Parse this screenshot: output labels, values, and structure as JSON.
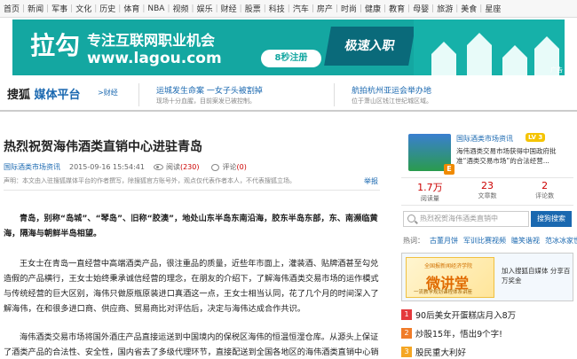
{
  "topnav": [
    "首页",
    "新闻",
    "军事",
    "文化",
    "历史",
    "体育",
    "NBA",
    "视频",
    "娱乐",
    "财经",
    "股票",
    "科技",
    "汽车",
    "房产",
    "时尚",
    "健康",
    "教育",
    "母婴",
    "旅游",
    "美食",
    "星座"
  ],
  "banner": {
    "logo": "拉勾",
    "slogan": "专注互联网职业机会",
    "url": "www.lagou.com",
    "register": "8秒注册",
    "fast": "极速入职",
    "ad_label": "广告"
  },
  "media": {
    "brand": "搜狐",
    "brand_sub": "媒体平台",
    "brand_tag": ">财经",
    "h1": "运城发生命案 一女子头被割掉",
    "h1_sub": "现场十分血腥，目前案发已被控制。",
    "h2": "航拍杭州亚运会举办地",
    "h2_sub": "位于萧山区钱江世纪城区域。"
  },
  "article": {
    "title": "热烈祝贺海伟酒类直销中心进驻青岛",
    "source": "国际酒类市场资讯",
    "time": "2015-09-16 15:54:41",
    "views_label": "阅读",
    "views": "(230)",
    "comments_label": "评论",
    "comments": "(0)",
    "notice": "声明：本文由入驻搜狐媒体平台的作者撰写，除搜狐官方账号外，观点仅代表作者本人，不代表搜狐立场。",
    "report": "举报",
    "paragraphs": [
      "青岛，别称“岛城”、“琴岛”、旧称“胶澳”，地处山东半岛东南沿海，胶东半岛东部，东、南濒临黄海，隔海与朝鲜半岛相望。",
      "王女士在青岛一直经营中高端酒类产品，很注重品的质量，近些年市面上，灌装酒、贴牌酒甚至勾兑造假的产品横行，王女士始终秉承诚信经营的理念，在朋友的介绍下，了解海伟酒类交易市场的运作模式与传统经营的巨大区别，海伟只做原瓶原装进口真酒这一点，王女士相当认同，花了几个月的时间深入了解海伟，在和很多进口商、供应商、贸易商比对评估后，决定与海伟达成合作共识。",
      "海伟酒类交易市场将国外酒庄产品直接运送到中国境内的保税区海伟的恒温恒湿仓库。从源头上保证了酒类产品的合法性、安全性，国内省去了多级代理环节，直接配送到全国各地区的海伟酒类直销中心销售给"
    ]
  },
  "sidebar": {
    "profile_name": "国际酒类市场资讯",
    "level": "LV 3",
    "avatar_badge": "E",
    "desc": "海伟酒类交易市场获得中国政府批准“酒类交易市场”的合法经营...",
    "stats": [
      {
        "num": "1.7万",
        "label": "阅读量"
      },
      {
        "num": "23",
        "label": "文章数"
      },
      {
        "num": "2",
        "label": "评论数"
      }
    ],
    "search_placeholder": "热烈祝贺海伟酒类直销中",
    "search_button": "搜狗搜索",
    "hot_label": "热词：",
    "hot_words": [
      "古董月饼",
      "军训比赛视频",
      "瞌笑谐视",
      "范冰冰家世"
    ],
    "ad": {
      "t1": "全国报新闻经济学院",
      "t2": "微讲堂",
      "t3": "一流教学规划课程体系讲座",
      "text": "加入搜狐自媒体 分享百万奖金"
    },
    "rank": [
      {
        "n": "1",
        "text": "90后美女开蛋糕店月入8万",
        "color": "#e4393c"
      },
      {
        "n": "2",
        "text": "炒股15年，悟出9个字!",
        "color": "#f07b28"
      },
      {
        "n": "3",
        "text": "股民重大利好",
        "color": "#f5a623"
      }
    ]
  }
}
